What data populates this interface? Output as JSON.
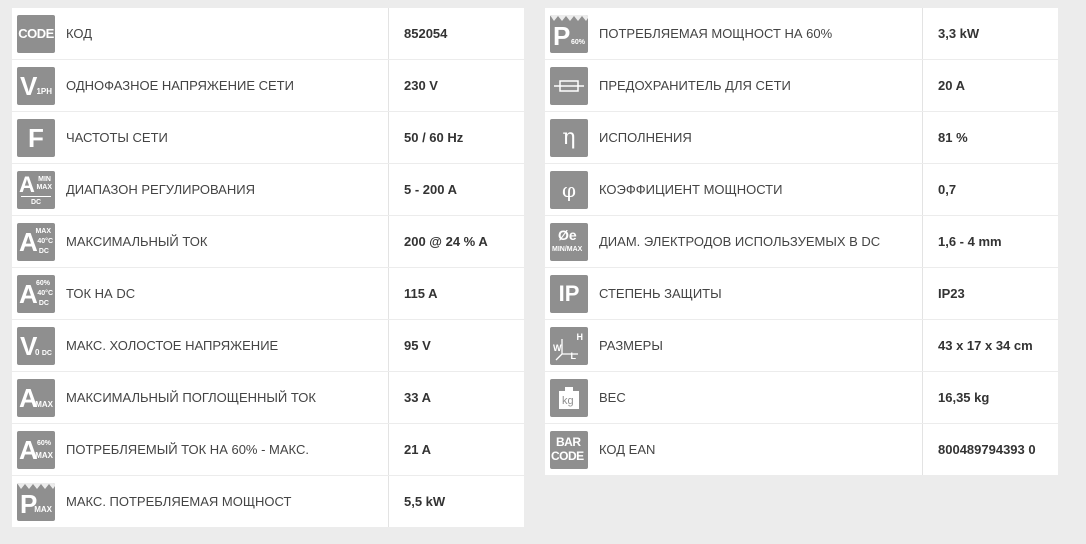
{
  "left": [
    {
      "icon": "code-icon",
      "label": "КОД",
      "value": "852054"
    },
    {
      "icon": "single-phase-voltage-icon",
      "label": "ОДНОФАЗНОЕ НАПРЯЖЕНИЕ СЕТИ",
      "value": "230 V"
    },
    {
      "icon": "frequency-icon",
      "label": "ЧАСТОТЫ СЕТИ",
      "value": "50 / 60 Hz"
    },
    {
      "icon": "regulation-range-icon",
      "label": "ДИАПАЗОН РЕГУЛИРОВАНИЯ",
      "value": "5 - 200 A"
    },
    {
      "icon": "max-current-icon",
      "label": "МАКСИМАЛЬНЫЙ ТОК",
      "value": "200 @ 24 % A"
    },
    {
      "icon": "dc-current-icon",
      "label": "ТОК НА DC",
      "value": "115 A"
    },
    {
      "icon": "open-circuit-voltage-icon",
      "label": "МАКС. ХОЛОСТОЕ НАПРЯЖЕНИЕ",
      "value": "95 V"
    },
    {
      "icon": "max-absorbed-current-icon",
      "label": "МАКСИМАЛЬНЫЙ ПОГЛОЩЕННЫЙ ТОК",
      "value": "33 A"
    },
    {
      "icon": "consumed-current-60-icon",
      "label": "ПОТРЕБЛЯЕМЫЙ ТОК НА 60% - МАКС.",
      "value": "21 A"
    },
    {
      "icon": "max-power-icon",
      "label": "МАКС. ПОТРЕБЛЯЕМАЯ МОЩНОСТ",
      "value": "5,5 kW"
    }
  ],
  "right": [
    {
      "icon": "power-60-icon",
      "label": "ПОТРЕБЛЯЕМАЯ МОЩНОСТ НА 60%",
      "value": "3,3 kW"
    },
    {
      "icon": "fuse-icon",
      "label": "ПРЕДОХРАНИТЕЛЬ ДЛЯ СЕТИ",
      "value": "20 A"
    },
    {
      "icon": "efficiency-icon",
      "label": "ИСПОЛНЕНИЯ",
      "value": "81 %"
    },
    {
      "icon": "power-factor-icon",
      "label": "КОЭФФИЦИЕНТ МОЩНОСТИ",
      "value": "0,7"
    },
    {
      "icon": "electrode-diameter-icon",
      "label": "ДИАМ. ЭЛЕКТРОДОВ ИСПОЛЬЗУЕМЫХ В DC",
      "value": "1,6 - 4 mm"
    },
    {
      "icon": "ip-protection-icon",
      "label": "СТЕПЕНЬ ЗАЩИТЫ",
      "value": "IP23"
    },
    {
      "icon": "dimensions-icon",
      "label": "РАЗМЕРЫ",
      "value": "43 x 17 x 34 cm"
    },
    {
      "icon": "weight-icon",
      "label": "ВЕС",
      "value": "16,35 kg"
    },
    {
      "icon": "barcode-icon",
      "label": "КОД EAN",
      "value": "800489794393 0"
    }
  ],
  "icons": {
    "code": "CODE",
    "v_main": "V",
    "v_sub": "1PH",
    "f": "F",
    "a": "A",
    "min": "MIN",
    "max": "MAX",
    "dc": "DC",
    "t40": "40°C",
    "p60": "60%",
    "v0": "0",
    "p": "P",
    "eta": "η",
    "phi": "φ",
    "oe": "Øe",
    "minmax": "MIN/MAX",
    "ip": "IP",
    "w": "W",
    "h": "H",
    "l": "L",
    "kg": "kg",
    "bar": "BAR",
    "barcode": "CODE"
  },
  "colors": {
    "icon_bg": "#8f8f8f",
    "row_bg": "#ffffff",
    "page_bg": "#ececec"
  }
}
